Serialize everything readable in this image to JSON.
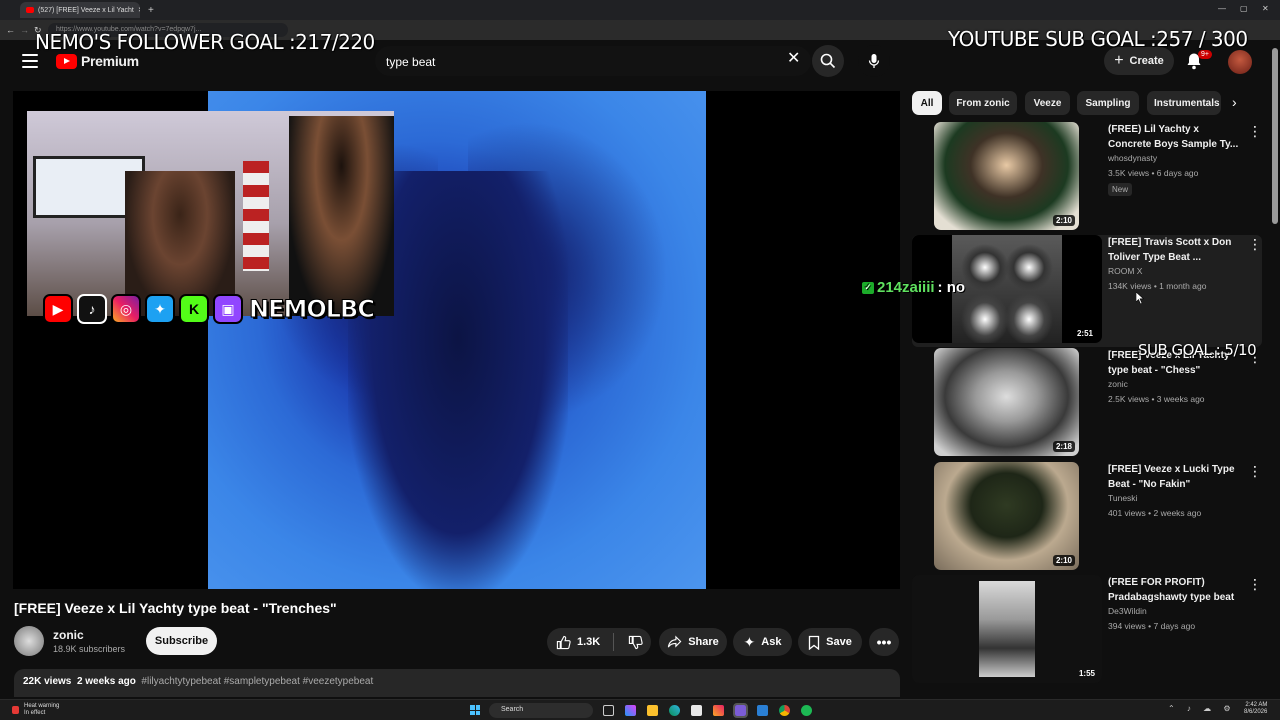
{
  "browser": {
    "tab_title": "(527) [FREE] Veeze x Lil Yacht",
    "url": "https://www.youtube.com/watch?v=7edpqw7j..."
  },
  "header": {
    "logo_text": "Premium",
    "search_value": "type beat",
    "create_label": "Create",
    "notif_badge": "9+"
  },
  "overlays": {
    "follower_goal": "NEMO'S FOLLOWER GOAL :217/220",
    "youtube_sub_goal": "YOUTUBE SUB GOAL :257 / 300",
    "sub_goal": "SUB GOAL : 5/10",
    "chat_user": "214zaiiii",
    "chat_text": ": no",
    "streamer_handle": "NEMOLBC"
  },
  "video": {
    "title": "[FREE] Veeze x Lil Yachty type beat - \"Trenches\"",
    "channel": "zonic",
    "subscribers": "18.9K subscribers",
    "subscribe_label": "Subscribe",
    "likes": "1.3K",
    "share_label": "Share",
    "ask_label": "Ask",
    "save_label": "Save",
    "views": "22K views",
    "age": "2 weeks ago",
    "tags": "#lilyachtytypebeat #sampletypebeat #veezetypebeat"
  },
  "chips": [
    "All",
    "From zonic",
    "Veeze",
    "Sampling",
    "Instrumentals"
  ],
  "recommendations": [
    {
      "title": "(FREE) Lil Yachty x Concrete Boys Sample Ty...",
      "channel": "whosdynasty",
      "meta": "3.5K views • 6 days ago",
      "badge": "New",
      "duration": "2:10"
    },
    {
      "title": "[FREE] Travis Scott x Don Toliver Type Beat ...",
      "channel": "ROOM X",
      "meta": "134K views • 1 month ago",
      "badge": "",
      "duration": "2:51"
    },
    {
      "title": "[FREE] Veeze x Lil Yachty type beat - \"Chess\"",
      "channel": "zonic",
      "meta": "2.5K views • 3 weeks ago",
      "badge": "",
      "duration": "2:18"
    },
    {
      "title": "[FREE] Veeze x Lucki Type Beat - \"No Fakin\"",
      "channel": "Tuneski",
      "meta": "401 views • 2 weeks ago",
      "badge": "",
      "duration": "2:10"
    },
    {
      "title": "(FREE FOR PROFIT) Pradabagshawty type beat",
      "channel": "De3Wildin",
      "meta": "394 views • 7 days ago",
      "badge": "",
      "duration": "1:55"
    }
  ],
  "taskbar": {
    "weather_line1": "Heat warning",
    "weather_line2": "In effect",
    "search_label": "Search",
    "time": "2:42 AM",
    "date": "8/6/2026"
  }
}
